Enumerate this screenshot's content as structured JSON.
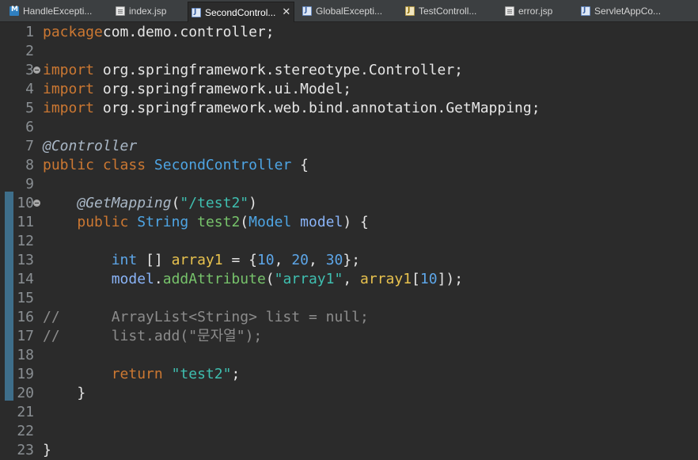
{
  "tabs": [
    {
      "label": "HandleExcepti...",
      "icon": "maven-file-icon",
      "type": "m"
    },
    {
      "label": "index.jsp",
      "icon": "jsp-file-icon",
      "type": "j"
    },
    {
      "label": "SecondControl...",
      "icon": "java-class-file-icon",
      "type": "c",
      "active": true
    },
    {
      "label": "GlobalExcepti...",
      "icon": "java-class-file-icon",
      "type": "c"
    },
    {
      "label": "TestControll...",
      "icon": "java-class-file-icon",
      "type": "t"
    },
    {
      "label": "error.jsp",
      "icon": "jsp-file-icon",
      "type": "j"
    },
    {
      "label": "ServletAppCo...",
      "icon": "java-class-file-icon",
      "type": "c"
    }
  ],
  "close_glyph": "✕",
  "lines": [
    {
      "n": "1",
      "tokens": [
        [
          "kw",
          "package"
        ],
        [
          "",
          "com.demo.controller;"
        ]
      ]
    },
    {
      "n": "2",
      "tokens": []
    },
    {
      "n": "3",
      "fold": true,
      "tokens": [
        [
          "kw",
          "import"
        ],
        [
          "",
          " org.springframework.stereotype.Controller;"
        ]
      ]
    },
    {
      "n": "4",
      "tokens": [
        [
          "kw",
          "import"
        ],
        [
          "",
          " org.springframework.ui.Model;"
        ]
      ]
    },
    {
      "n": "5",
      "tokens": [
        [
          "kw",
          "import"
        ],
        [
          "",
          " org.springframework.web.bind.annotation.GetMapping;"
        ]
      ]
    },
    {
      "n": "6",
      "tokens": []
    },
    {
      "n": "7",
      "tokens": [
        [
          "ann",
          "@Controller"
        ]
      ]
    },
    {
      "n": "8",
      "tokens": [
        [
          "kw",
          "public"
        ],
        [
          "",
          " "
        ],
        [
          "kw",
          "class"
        ],
        [
          "",
          " "
        ],
        [
          "cls",
          "SecondController"
        ],
        [
          "",
          " {"
        ]
      ]
    },
    {
      "n": "9",
      "tokens": []
    },
    {
      "n": "10",
      "fold": true,
      "tokens": [
        [
          "",
          "    "
        ],
        [
          "ann",
          "@GetMapping"
        ],
        [
          "",
          "("
        ],
        [
          "str",
          "\"/test2\""
        ],
        [
          "",
          ")"
        ]
      ]
    },
    {
      "n": "11",
      "tokens": [
        [
          "",
          "    "
        ],
        [
          "kw",
          "public"
        ],
        [
          "",
          " "
        ],
        [
          "cls",
          "String"
        ],
        [
          "",
          " "
        ],
        [
          "meth",
          "test2"
        ],
        [
          "",
          "("
        ],
        [
          "cls",
          "Model"
        ],
        [
          "",
          " "
        ],
        [
          "param",
          "model"
        ],
        [
          "",
          ") {"
        ]
      ]
    },
    {
      "n": "12",
      "tokens": []
    },
    {
      "n": "13",
      "tokens": [
        [
          "",
          "        "
        ],
        [
          "typ",
          "int"
        ],
        [
          "",
          " [] "
        ],
        [
          "var",
          "array1"
        ],
        [
          "",
          " = {"
        ],
        [
          "num",
          "10"
        ],
        [
          "",
          ", "
        ],
        [
          "num",
          "20"
        ],
        [
          "",
          ", "
        ],
        [
          "num",
          "30"
        ],
        [
          "",
          "};"
        ]
      ]
    },
    {
      "n": "14",
      "tokens": [
        [
          "",
          "        "
        ],
        [
          "param",
          "model"
        ],
        [
          "",
          "."
        ],
        [
          "meth",
          "addAttribute"
        ],
        [
          "",
          "("
        ],
        [
          "str",
          "\"array1\""
        ],
        [
          "",
          ", "
        ],
        [
          "var",
          "array1"
        ],
        [
          "",
          "["
        ],
        [
          "num",
          "10"
        ],
        [
          "",
          "]);"
        ]
      ]
    },
    {
      "n": "15",
      "tokens": []
    },
    {
      "n": "16",
      "tokens": [
        [
          "cmt",
          "//      ArrayList<String> list = null;"
        ]
      ]
    },
    {
      "n": "17",
      "tokens": [
        [
          "cmt",
          "//      list.add(\"문자열\");"
        ]
      ]
    },
    {
      "n": "18",
      "tokens": []
    },
    {
      "n": "19",
      "tokens": [
        [
          "",
          "        "
        ],
        [
          "kw",
          "return"
        ],
        [
          "",
          " "
        ],
        [
          "str",
          "\"test2\""
        ],
        [
          "",
          ";"
        ]
      ]
    },
    {
      "n": "20",
      "tokens": [
        [
          "",
          "    }"
        ]
      ]
    },
    {
      "n": "21",
      "tokens": []
    },
    {
      "n": "22",
      "tokens": []
    },
    {
      "n": "23",
      "tokens": [
        [
          "",
          "}"
        ]
      ]
    }
  ],
  "colors": {
    "background": "#2b2b2b",
    "keyword": "#cc7832",
    "type": "#4ea5e4",
    "string": "#3fbfb0",
    "method": "#77c36b",
    "number": "#5da6e8",
    "comment": "#8c8c8c"
  }
}
